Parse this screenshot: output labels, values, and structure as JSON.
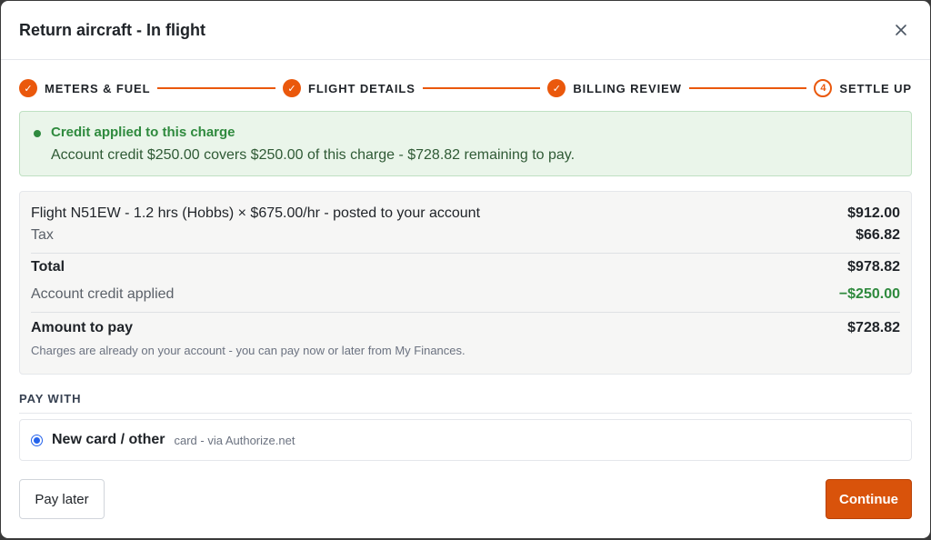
{
  "modal": {
    "title": "Return aircraft - In flight"
  },
  "stepper": {
    "steps": [
      {
        "number": "✓",
        "label": "METERS & FUEL",
        "state": "done"
      },
      {
        "number": "✓",
        "label": "FLIGHT DETAILS",
        "state": "done"
      },
      {
        "number": "✓",
        "label": "BILLING REVIEW",
        "state": "done"
      },
      {
        "number": "4",
        "label": "SETTLE UP",
        "state": "current"
      }
    ]
  },
  "banner": {
    "title": "Credit applied to this charge",
    "text": "Account credit $250.00 covers $250.00 of this charge - $728.82 remaining to pay."
  },
  "summary": {
    "line_item": {
      "label": "Flight N51EW - 1.2 hrs (Hobbs) × $675.00/hr - posted to your account",
      "amount": "$912.00"
    },
    "tax": {
      "label": "Tax",
      "amount": "$66.82"
    },
    "total": {
      "label": "Total",
      "amount": "$978.82"
    },
    "credit": {
      "label": "Account credit applied",
      "amount": "−$250.00"
    },
    "due": {
      "label": "Amount to pay",
      "amount": "$728.82"
    },
    "note": "Charges are already on your account - you can pay now or later from My Finances."
  },
  "pay_with": {
    "heading": "PAY WITH",
    "method_label": "New card / other",
    "method_sub": "card - via Authorize.net"
  },
  "actions": {
    "pay_later": "Pay later",
    "continue": "Continue"
  },
  "colors": {
    "accent": "#ea580c",
    "success": "#2f8a3e",
    "radio": "#2563eb"
  },
  "icons": {
    "close": "close-icon",
    "check": "check-icon"
  }
}
